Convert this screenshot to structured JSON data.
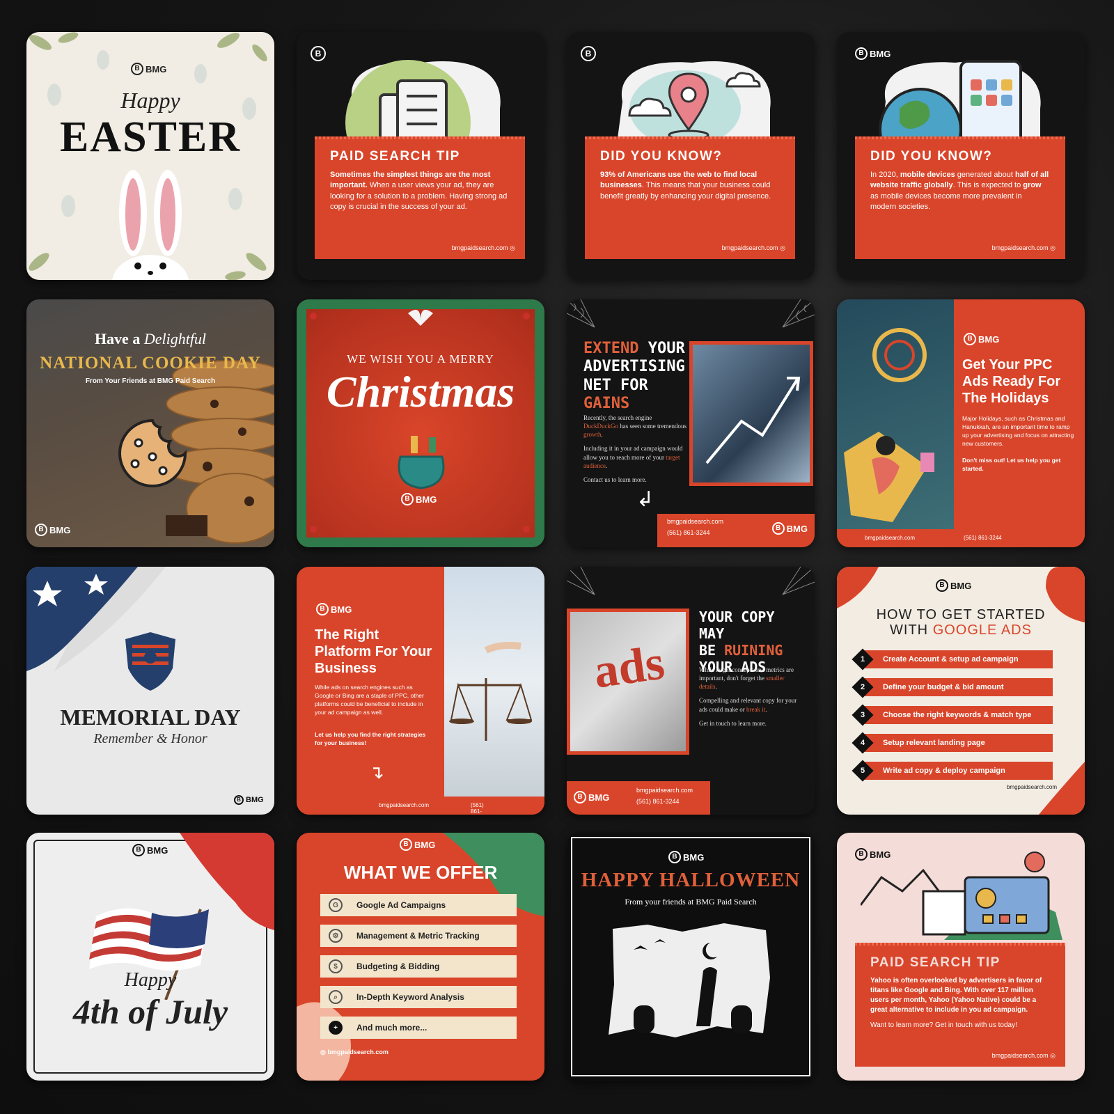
{
  "brand": {
    "logo": "BMG",
    "logo_sub": "PAID SEARCH",
    "site": "bmgpaidsearch.com",
    "phone": "(561) 861-3244"
  },
  "tiles": {
    "easter": {
      "happy": "Happy",
      "title": "EASTER"
    },
    "tip1": {
      "title": "PAID SEARCH TIP",
      "bold": "Sometimes the simplest things are the most important.",
      "body": " When a user views your ad, they are looking for a solution to a problem. Having strong ad copy is crucial in the success of your ad."
    },
    "dyk1": {
      "title": "DID YOU KNOW?",
      "bold": "93% of Americans use the web to find local businesses",
      "body": ". This means that your business could benefit greatly by enhancing your digital presence."
    },
    "dyk2": {
      "title": "DID YOU KNOW?",
      "p1": "In 2020, ",
      "b1": "mobile devices",
      "p2": " generated about ",
      "b2": "half of all website traffic globally",
      "p3": ". This is expected to ",
      "b3": "grow",
      "p4": " as mobile devices become more prevalent in modern societies."
    },
    "cookie": {
      "line1a": "Have a ",
      "line1b": "Delightful",
      "line2": "NATIONAL COOKIE DAY",
      "line3": "From Your Friends at BMG Paid Search"
    },
    "christmas": {
      "line1": "WE WISH YOU A MERRY",
      "line2": "Christmas"
    },
    "extend": {
      "h1": "EXTEND",
      "h2": " YOUR",
      "h3": "ADVERTISING",
      "h4": "NET FOR ",
      "h5": "GAINS",
      "p1a": "Recently, the search engine ",
      "p1b": "DuckDuckGo",
      "p1c": " has seen some tremendous ",
      "p1d": "growth",
      "p1e": ".",
      "p2a": "Including it in your ad campaign would allow you to reach more of your ",
      "p2b": "target audience",
      "p2c": ".",
      "p3": "Contact us to learn more."
    },
    "ppc": {
      "title": "Get Your PPC Ads Ready For The Holidays",
      "p1": "Major Holidays, such as Christmas and Hanukkah, are an important time to ramp up your advertising and focus on attracting new customers.",
      "p2": "Don't miss out! Let us help you get started."
    },
    "memorial": {
      "title": "MEMORIAL DAY",
      "sub": "Remember & Honor"
    },
    "platform": {
      "title": "The Right Platform For Your Business",
      "p1": "While ads on search engines such as Google or Bing are a staple of PPC, other platforms could be beneficial to include in your ad campaign as well.",
      "p2": "Let us help you find the right strategies for your business!"
    },
    "copy": {
      "h1": "YOUR COPY MAY",
      "h2": "BE ",
      "h3": "RUINING",
      "h4": "YOUR ADS",
      "p1a": "While larger concepts and metrics are important, don't forget the ",
      "p1b": "smaller details",
      "p1c": ".",
      "p2a": "Compelling and relevant copy for your ads could make or ",
      "p2b": "break it",
      "p2c": ".",
      "p3": "Get in touch to learn more.",
      "word": "ads"
    },
    "howto": {
      "title1": "HOW TO GET STARTED",
      "title2a": "WITH ",
      "title2b": "GOOGLE ADS",
      "steps": [
        "Create Account & setup ad campaign",
        "Define your budget & bid amount",
        "Choose the right keywords & match type",
        "Setup relevant landing page",
        "Write ad copy & deploy campaign"
      ],
      "nums": [
        "1",
        "2",
        "3",
        "4",
        "5"
      ]
    },
    "july": {
      "happy": "Happy",
      "title": "4th of July"
    },
    "offer": {
      "title1": "WHAT WE ",
      "title2": "OFFER",
      "items": [
        "Google Ad Campaigns",
        "Management & Metric Tracking",
        "Budgeting & Bidding",
        "In-Depth Keyword Analysis",
        "And much more..."
      ]
    },
    "halloween": {
      "title": "HAPPY HALLOWEEN",
      "sub": "From your friends at BMG Paid Search"
    },
    "tip2": {
      "title": "PAID SEARCH TIP",
      "p1": "Yahoo is often overlooked by advertisers in favor of titans like Google and Bing. With over 117 million users per month, Yahoo (Yahoo Native) could be a great alternative to include in you ad campaign.",
      "p2": "Want to learn more? Get in touch with us today!"
    }
  },
  "colors": {
    "accent": "#d9452a",
    "cream": "#f2ece2",
    "dark": "#141414",
    "green": "#3f8f5e"
  },
  "icons": [
    "b-logo-icon",
    "globe-icon",
    "document-icon",
    "map-pin-icon",
    "cloud-icon",
    "phone-icon",
    "earth-icon",
    "cookie-icon",
    "gift-sack-icon",
    "bunny-icon",
    "shield-icon",
    "flag-icon",
    "scale-icon",
    "arrow-icon",
    "spiderweb-icon",
    "bat-icon",
    "hand-icon",
    "google-icon",
    "plus-icon"
  ]
}
